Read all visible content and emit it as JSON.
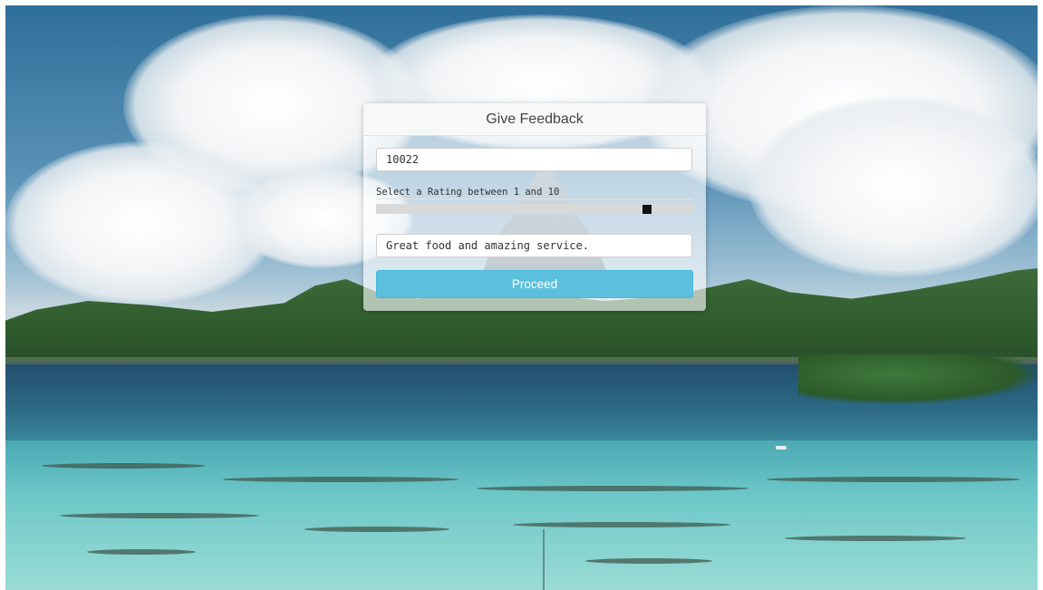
{
  "form": {
    "title": "Give Feedback",
    "id_value": "10022",
    "rating_label": "Select a Rating between 1 and 10",
    "rating_min": 1,
    "rating_max": 10,
    "rating_value": 9,
    "comment_value": "Great food and amazing service.",
    "proceed_label": "Proceed"
  },
  "colors": {
    "button": "#5bc0de",
    "slider_track": "#d9d9d9",
    "slider_thumb": "#111111"
  }
}
